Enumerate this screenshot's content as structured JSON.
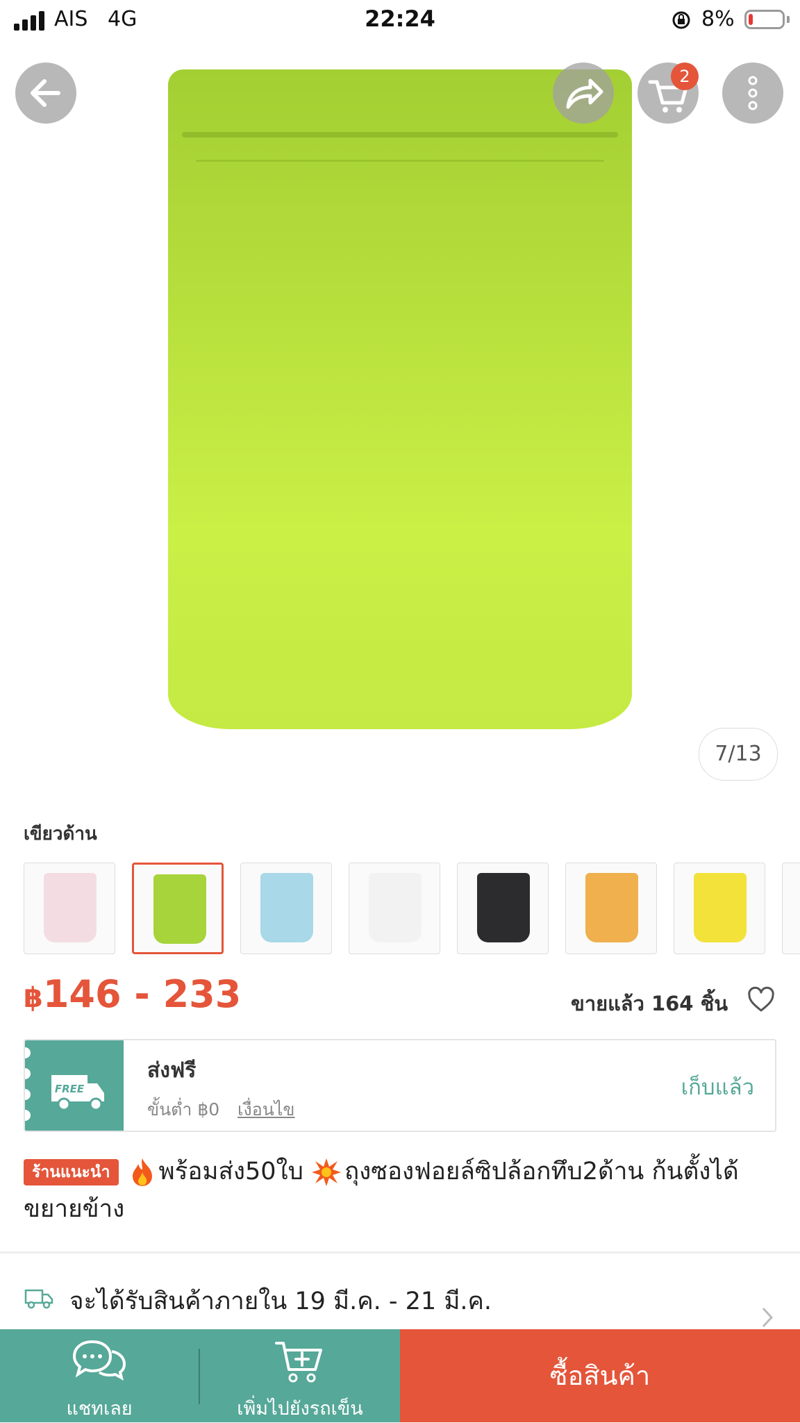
{
  "status_bar": {
    "carrier": "AIS",
    "network": "4G",
    "time": "22:24",
    "battery": "8%"
  },
  "product": {
    "image_counter": "7/13",
    "cart_count": "2",
    "variant_label": "เขียวด้าน",
    "variants": [
      {
        "color": "#f3dde3",
        "selected": false
      },
      {
        "color": "#a6d43a",
        "selected": true
      },
      {
        "color": "#a9d8e8",
        "selected": false
      },
      {
        "color": "#f2f2f2",
        "selected": false
      },
      {
        "color": "#2c2c2e",
        "selected": false
      },
      {
        "color": "#efb04d",
        "selected": false
      },
      {
        "color": "#f2e23a",
        "selected": false
      },
      {
        "color": "#e8dbe4",
        "selected": false
      }
    ],
    "price_currency": "฿",
    "price_range": "146 - 233",
    "sold": "ขายแล้ว 164 ชิ้น",
    "badge": "ร้านแนะนำ",
    "title": "พร้อมส่ง50ใบ",
    "title_rest": "ถุงซองฟอยล์ซิปล้อกทึบ2ด้าน ก้นตั้งได้ ขยายข้าง"
  },
  "voucher": {
    "logo_text": "FREE",
    "title": "ส่งฟรี",
    "min_spend": "ขั้นต่ำ ฿0",
    "conditions": "เงื่อนไข",
    "status": "เก็บแล้ว"
  },
  "delivery": {
    "text": "จะได้รับสินค้าภายใน 19 มี.ค. - 21 มี.ค."
  },
  "bottom_bar": {
    "chat_label": "แชทเลย",
    "add_to_cart_label": "เพิ่มไปยังรถเข็น",
    "buy_label": "ซื้อสินค้า"
  },
  "colors": {
    "accent": "#e4553a",
    "teal": "#56a898"
  }
}
